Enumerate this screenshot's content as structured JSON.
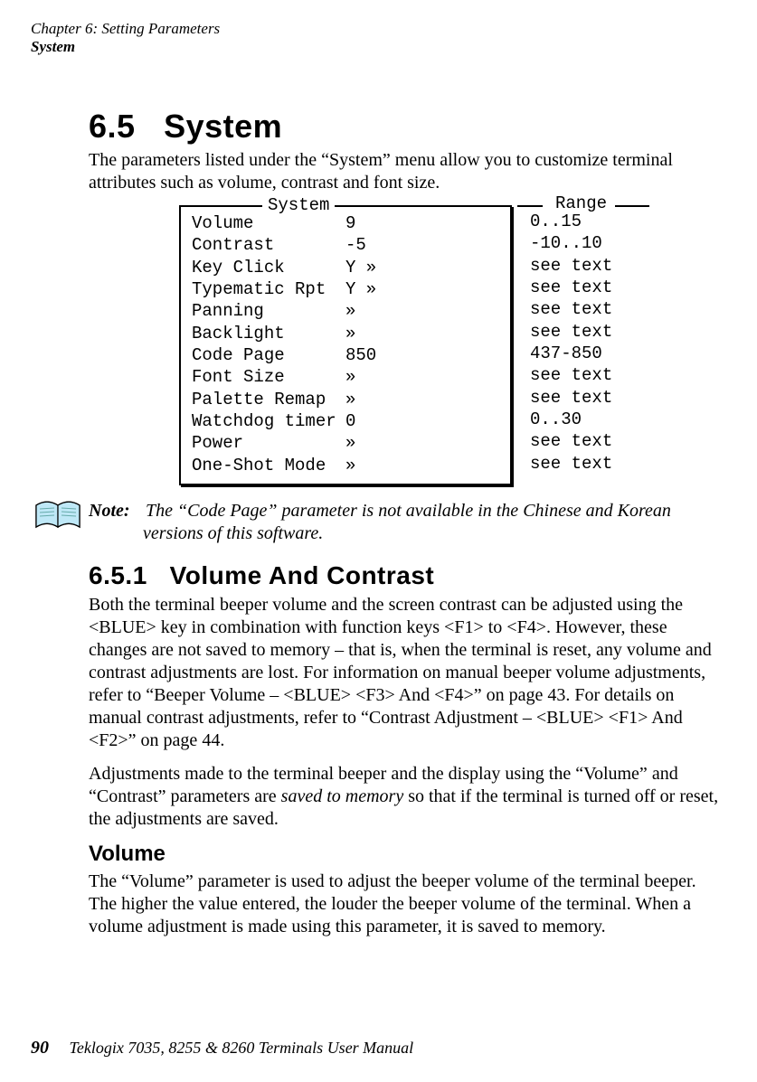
{
  "header": {
    "chapter": "Chapter 6:  Setting Parameters",
    "topic": "System"
  },
  "section": {
    "number": "6.5",
    "title": "System",
    "intro": "The parameters listed under the “System” menu allow you to customize terminal attributes such as volume, contrast and font size."
  },
  "diagram": {
    "box_title": "System",
    "range_title": "Range",
    "rows": [
      {
        "label": "Volume",
        "value": "9",
        "range": "0..15"
      },
      {
        "label": "Contrast",
        "value": "-5",
        "range": "-10..10"
      },
      {
        "label": "Key Click",
        "value": "Y »",
        "range": "see text"
      },
      {
        "label": "Typematic Rpt",
        "value": "Y »",
        "range": "see text"
      },
      {
        "label": "Panning",
        "value": "»",
        "range": "see text"
      },
      {
        "label": "Backlight",
        "value": "»",
        "range": "see text"
      },
      {
        "label": "Code Page",
        "value": "850",
        "range": "437-850"
      },
      {
        "label": "Font Size",
        "value": "»",
        "range": "see text"
      },
      {
        "label": "Palette Remap",
        "value": "»",
        "range": "see text"
      },
      {
        "label": "Watchdog timer",
        "value": "0",
        "range": "0..30"
      },
      {
        "label": "Power",
        "value": "»",
        "range": "see text"
      },
      {
        "label": "One-Shot Mode",
        "value": "»",
        "range": "see text"
      }
    ]
  },
  "note": {
    "label": "Note:",
    "text_line1": "The “Code Page” parameter is not available in the Chinese and Korean",
    "text_line2": "versions of this software."
  },
  "subsection": {
    "number": "6.5.1",
    "title": "Volume And Contrast",
    "para1": "Both the terminal beeper volume and the screen contrast can be adjusted using the <BLUE> key in combination with function keys <F1> to <F4>. However, these changes are not saved to memory – that is, when the terminal is reset, any volume and contrast adjustments are lost. For information on manual beeper volume adjustments, refer to “Beeper Volume – <BLUE> <F3> And <F4>” on page 43. For details on manual contrast adjustments, refer to “Contrast Adjustment – <BLUE> <F1> And <F2>” on page 44.",
    "para2_pre": "Adjustments made to the terminal beeper and the display using the “Volume” and “Contrast” parameters are ",
    "para2_em": "saved to memory",
    "para2_post": " so that if the terminal is turned off or reset, the adjustments are saved."
  },
  "volume": {
    "heading": "Volume",
    "para": "The “Volume” parameter is used to adjust the beeper volume of the terminal beeper. The higher the value entered, the louder the beeper volume of the terminal. When a volume adjustment is made using this parameter, it is saved to memory."
  },
  "footer": {
    "page": "90",
    "manual": "Teklogix 7035, 8255 & 8260 Terminals User Manual"
  }
}
